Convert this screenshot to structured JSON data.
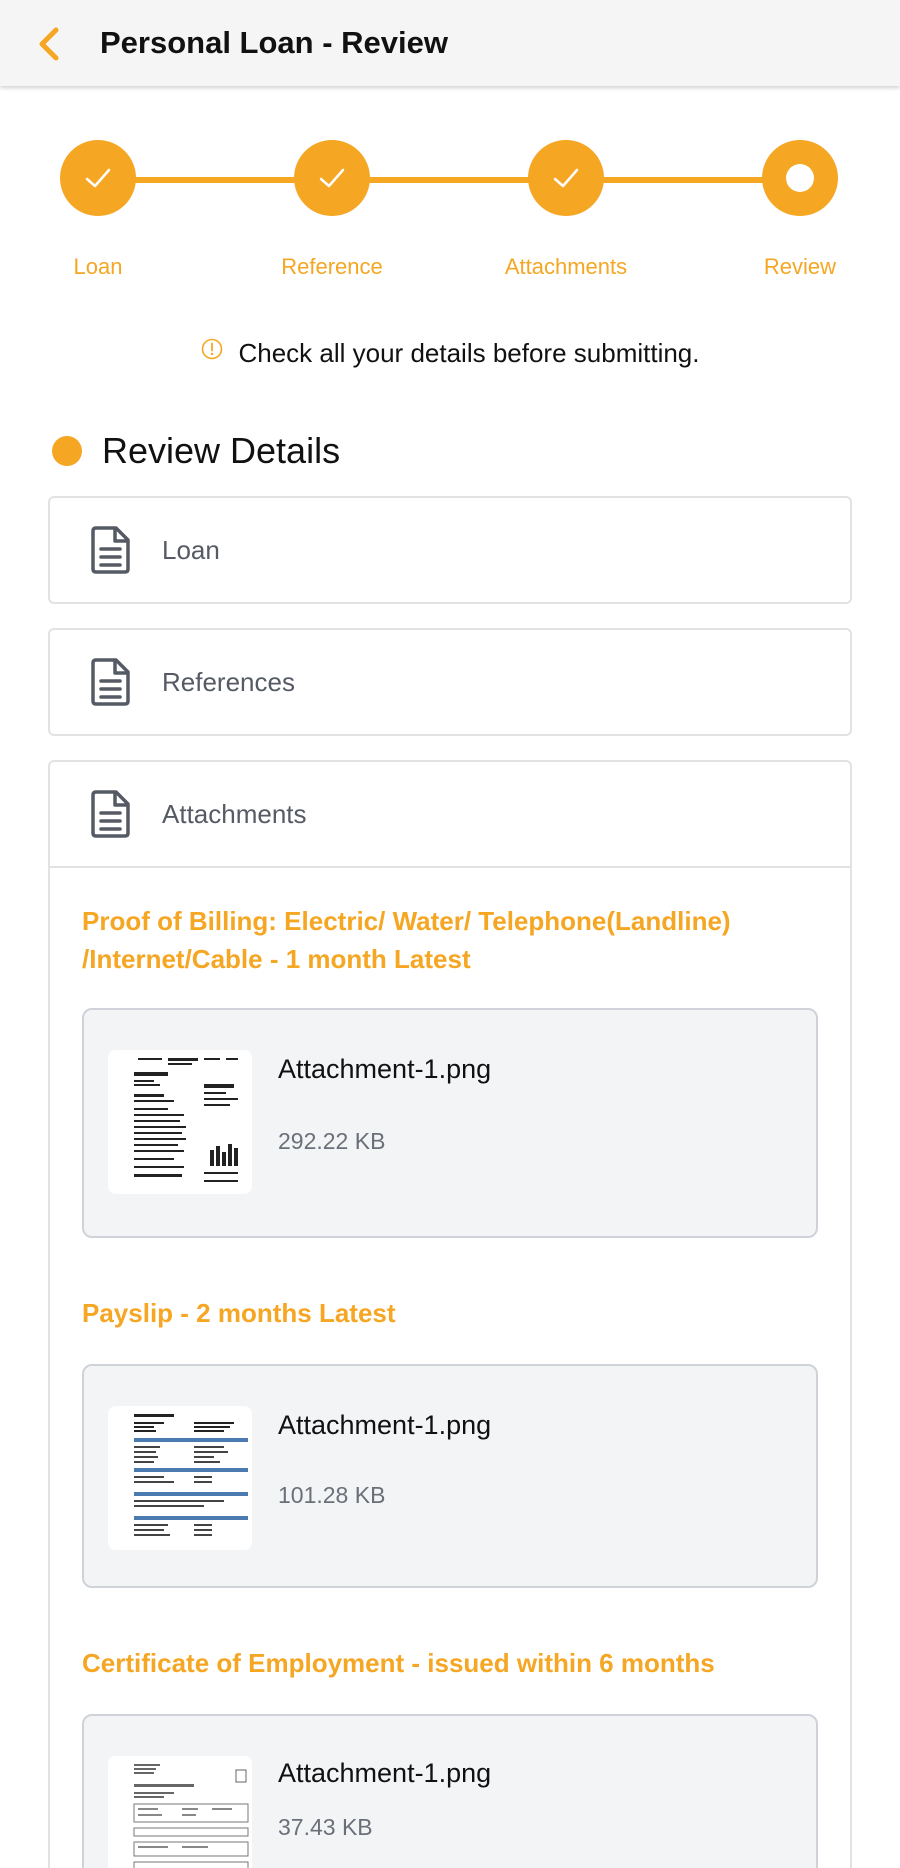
{
  "header": {
    "title": "Personal Loan - Review"
  },
  "steps": [
    {
      "label": "Loan",
      "state": "done"
    },
    {
      "label": "Reference",
      "state": "done"
    },
    {
      "label": "Attachments",
      "state": "done"
    },
    {
      "label": "Review",
      "state": "current"
    }
  ],
  "notice": {
    "text": "Check all your details before submitting."
  },
  "review": {
    "title": "Review Details",
    "sections": [
      {
        "label": "Loan"
      },
      {
        "label": "References"
      },
      {
        "label": "Attachments"
      }
    ]
  },
  "attachments": [
    {
      "title": "Proof of Billing: Electric/ Water/ Telephone(Landline) /Internet/Cable - 1 month Latest",
      "file": "Attachment-1.png",
      "size": "292.22 KB"
    },
    {
      "title": "Payslip - 2 months Latest",
      "file": "Attachment-1.png",
      "size": "101.28 KB"
    },
    {
      "title": "Certificate of Employment - issued within 6 months",
      "file": "Attachment-1.png",
      "size": "37.43 KB"
    }
  ],
  "colors": {
    "accent": "#f5a623",
    "muted": "#555a64",
    "border": "#e2e2e4"
  }
}
